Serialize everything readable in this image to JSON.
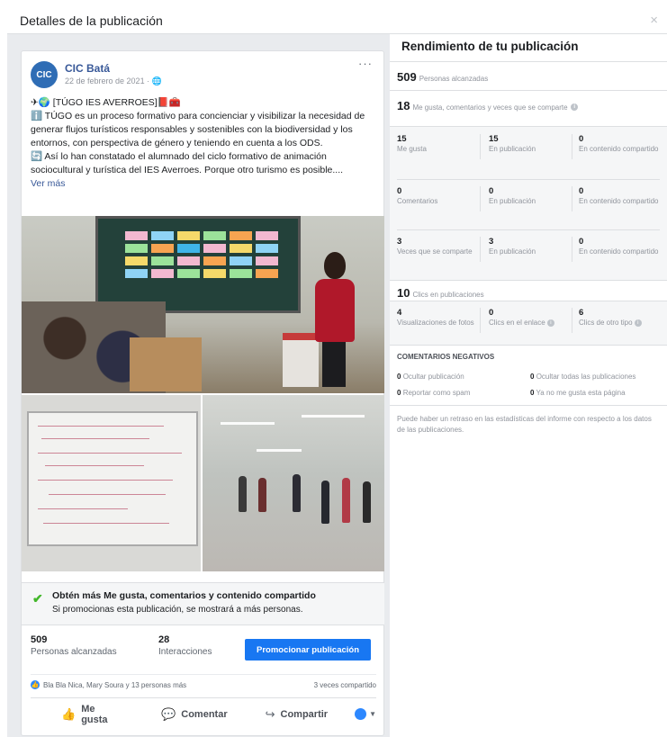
{
  "dialog": {
    "title": "Detalles de la publicación",
    "close": "×"
  },
  "post": {
    "page_name": "CIC Batá",
    "avatar_text": "CIC",
    "date": "22 de febrero de 2021 · ",
    "privacy_icon": "globe-icon",
    "more": "···",
    "text_lines": [
      "✈🌍 [TÚGO IES AVERROES]📕🧰",
      "ℹ️ TÚGO es un proceso formativo para concienciar y visibilizar la necesidad de generar flujos turísticos responsables y sostenibles con la biodiversidad y los entornos, con perspectiva de género y teniendo en cuenta a los ODS.",
      "🔄 Así lo han constatado el alumnado del ciclo formativo de animación sociocultural y turística del IES Averroes. Porque otro turismo es posible...."
    ],
    "see_more": "Ver más"
  },
  "promo": {
    "title": "Obtén más Me gusta, comentarios y contenido compartido",
    "subtitle": "Si promocionas esta publicación, se mostrará a más personas."
  },
  "bottom_stats": {
    "reach_value": "509",
    "reach_label": "Personas alcanzadas",
    "interactions_value": "28",
    "interactions_label": "Interacciones",
    "promote_button": "Promocionar publicación"
  },
  "reactions": {
    "names": "Bla Bla Nica, Mary Soura y 13 personas más",
    "shares": "3 veces compartido"
  },
  "actions": {
    "like": "Me gusta",
    "comment": "Comentar",
    "share": "Compartir",
    "like_icon": "thumbs-up-icon",
    "comment_icon": "comment-icon",
    "share_icon": "share-arrow-icon"
  },
  "performance": {
    "title": "Rendimiento de tu publicación",
    "reach_value": "509",
    "reach_label": "Personas alcanzadas",
    "engagement_value": "18",
    "engagement_label": "Me gusta, comentarios y veces que se comparte",
    "grid": [
      [
        {
          "n": "15",
          "l": "Me gusta"
        },
        {
          "n": "15",
          "l": "En publicación"
        },
        {
          "n": "0",
          "l": "En contenido compartido"
        }
      ],
      [
        {
          "n": "0",
          "l": "Comentarios"
        },
        {
          "n": "0",
          "l": "En publicación"
        },
        {
          "n": "0",
          "l": "En contenido compartido"
        }
      ],
      [
        {
          "n": "3",
          "l": "Veces que se comparte"
        },
        {
          "n": "3",
          "l": "En publicación"
        },
        {
          "n": "0",
          "l": "En contenido compartido"
        }
      ]
    ],
    "clicks_value": "10",
    "clicks_label": "Clics en publicaciones",
    "clicks_grid": [
      {
        "n": "4",
        "l": "Visualizaciones de fotos"
      },
      {
        "n": "0",
        "l": "Clics en el enlace"
      },
      {
        "n": "6",
        "l": "Clics de otro tipo"
      }
    ],
    "negative_title": "COMENTARIOS NEGATIVOS",
    "negative": [
      {
        "n": "0",
        "l": "Ocultar publicación"
      },
      {
        "n": "0",
        "l": "Ocultar todas las publicaciones"
      },
      {
        "n": "0",
        "l": "Reportar como spam"
      },
      {
        "n": "0",
        "l": "Ya no me gusta esta página"
      }
    ],
    "note": "Puede haber un retraso en las estadísticas del informe con respecto a los datos de las publicaciones."
  },
  "colors": {
    "brand": "#1877f2",
    "link": "#385898",
    "success": "#42b72a"
  }
}
